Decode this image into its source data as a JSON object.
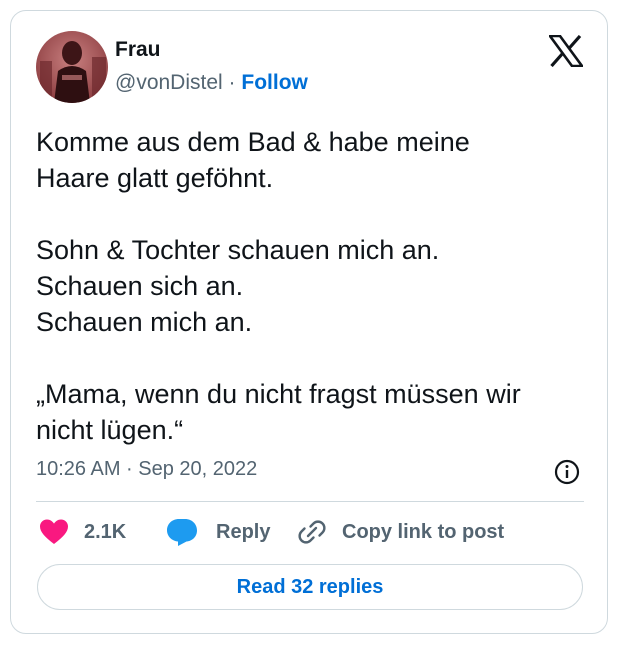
{
  "author": {
    "name": "Frau",
    "handle": "@vonDistel",
    "separator": "·",
    "follow_label": "Follow"
  },
  "logo_icon": "x-logo-icon",
  "tweet": {
    "text": "Komme aus dem Bad & habe meine\nHaare glatt geföhnt.\n\nSohn & Tochter schauen mich an.\nSchauen sich an.\nSchauen mich an.\n\n„Mama, wenn du nicht fragst müssen wir\nnicht lügen.“",
    "timestamp": "10:26 AM · Sep 20, 2022"
  },
  "actions": {
    "like_count": "2.1K",
    "reply_label": "Reply",
    "copy_link_label": "Copy link to post"
  },
  "read_replies_label": "Read 32 replies",
  "colors": {
    "accent": "#006fd6",
    "like": "#f91880",
    "reply": "#1d9bf0",
    "text": "#0f1419",
    "muted": "#536471",
    "border": "#cfd9de"
  }
}
